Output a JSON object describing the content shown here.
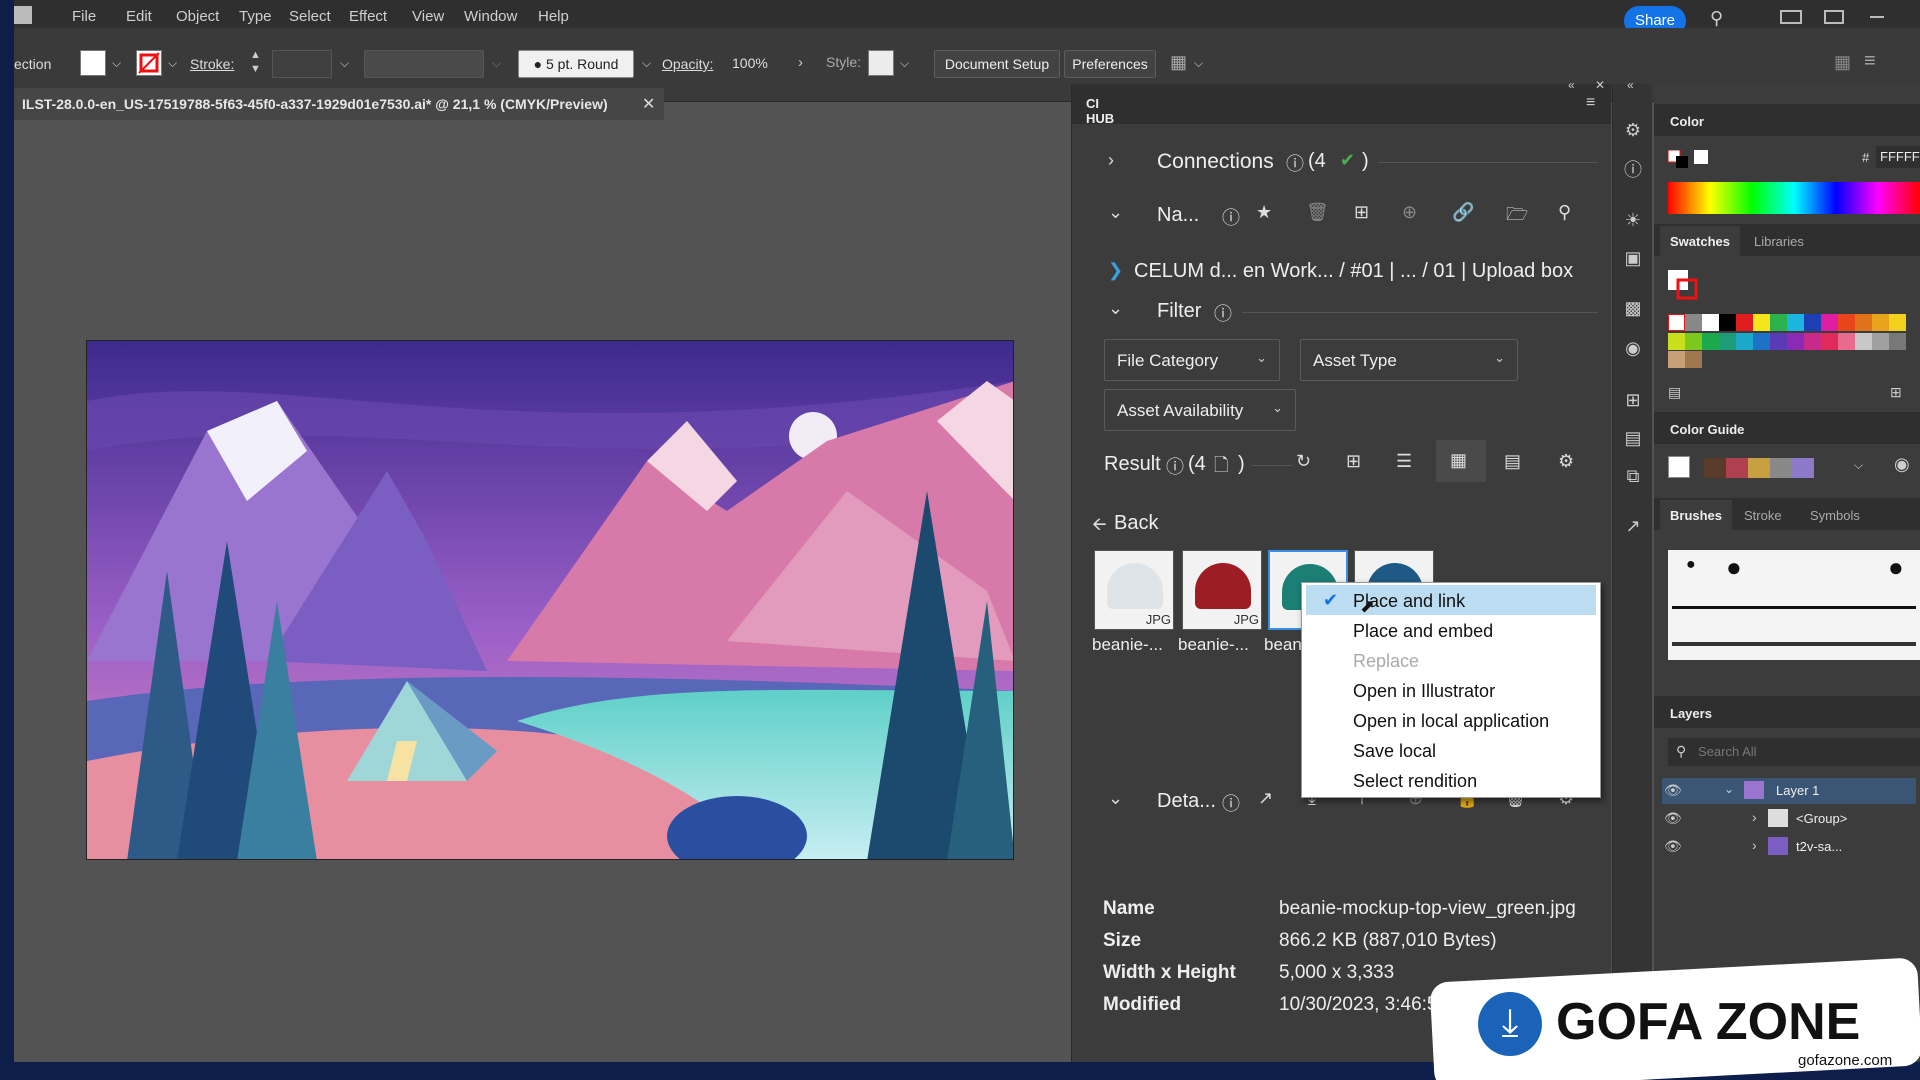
{
  "menu": [
    "File",
    "Edit",
    "Object",
    "Type",
    "Select",
    "Effect",
    "View",
    "Window",
    "Help"
  ],
  "share_label": "Share",
  "control_bar": {
    "selection_label": "ection",
    "stroke_label": "Stroke:",
    "brush_label": "5 pt. Round",
    "opacity_label": "Opacity:",
    "opacity_value": "100%",
    "style_label": "Style:",
    "document_setup": "Document Setup",
    "preferences": "Preferences"
  },
  "document_tab": "ILST-28.0.0-en_US-17519788-5f63-45f0-a337-1929d01e7530.ai* @ 21,1 % (CMYK/Preview)",
  "cihub": {
    "tab": "CI HUB",
    "connections_label": "Connections",
    "connections_count": "(4",
    "connections_close": ")",
    "nav_label": "Na...",
    "breadcrumb": "CELUM d... en  Work... / #01 | ... / 01 | Upload box",
    "filter_label": "Filter",
    "filters": [
      "File Category",
      "Asset Type",
      "Asset Availability"
    ],
    "result_label": "Result",
    "result_count": "(4",
    "result_close": ")",
    "back_label": "Back",
    "thumbnails": [
      {
        "label": "beanie-...",
        "tag": "JPG",
        "color": "#dfe4e8"
      },
      {
        "label": "beanie-...",
        "tag": "JPG",
        "color": "#9e1c24"
      },
      {
        "label": "bean",
        "tag": "",
        "color": "#1c7f76"
      },
      {
        "label": "",
        "tag": "",
        "color": "#1f5a86"
      }
    ],
    "context_menu": [
      "Place and link",
      "Place and embed",
      "Replace",
      "Open in Illustrator",
      "Open in local application",
      "Save local",
      "Select rendition"
    ],
    "details_label": "Deta...",
    "details": [
      {
        "label": "Name",
        "value": "beanie-mockup-top-view_green.jpg"
      },
      {
        "label": "Size",
        "value": "866.2 KB (887,010 Bytes)"
      },
      {
        "label": "Width x Height",
        "value": "5,000 x 3,333"
      },
      {
        "label": "Modified",
        "value": "10/30/2023, 3:46:5"
      }
    ]
  },
  "panels": {
    "color_tab": "Color",
    "hex_symbol": "#",
    "hex_value": "FFFFF",
    "swatches_tab": "Swatches",
    "libraries_tab": "Libraries",
    "color_guide_tab": "Color Guide",
    "brushes_tab": "Brushes",
    "stroke_tab": "Stroke",
    "symbols_tab": "Symbols",
    "layers_tab": "Layers",
    "search_placeholder": "Search All",
    "layers": [
      "Layer 1",
      "<Group>",
      "t2v-sa..."
    ]
  },
  "watermark": {
    "brand": "GOFA ZONE",
    "url": "gofazone.com"
  }
}
